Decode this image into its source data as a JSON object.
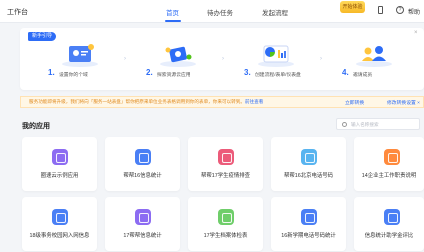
{
  "header": {
    "app_title": "工作台",
    "tabs": [
      {
        "label": "首页",
        "active": true
      },
      {
        "label": "待办任务",
        "active": false
      },
      {
        "label": "发起流程",
        "active": false
      }
    ],
    "promo_badge": "开始体验",
    "help_label": "帮助",
    "help_glyph": "?"
  },
  "guide": {
    "badge": "新手引导",
    "close_glyph": "×",
    "steps": [
      {
        "num": "1.",
        "label": "设置你的个域"
      },
      {
        "num": "2.",
        "label": "探索资源云应用"
      },
      {
        "num": "3.",
        "label": "创建流程/表单/仪表盘"
      },
      {
        "num": "4.",
        "label": "邀请成员"
      }
    ],
    "arrow": "›"
  },
  "notice": {
    "text": "服务功能即将升级，我们将向「服务一站表盘」帮你把原来单位业务表格调用到你的表单，你来可以转到。",
    "link": "前往查看",
    "action_1": "立即转换",
    "action_2": "修改转换设置 ×"
  },
  "apps": {
    "heading": "我的应用",
    "search_placeholder": "输入名称搜索",
    "items": [
      {
        "label": "圈速云示例应用",
        "color": "#8c6cf2"
      },
      {
        "label": "帮帮16信息统计",
        "color": "#4a7ff5"
      },
      {
        "label": "帮帮17学生疫情排查",
        "color": "#ec5b7a"
      },
      {
        "label": "帮帮16北京电话号码",
        "color": "#58b4f0"
      },
      {
        "label": "14企业主工作职责说明",
        "color": "#ff8a3d"
      },
      {
        "label": "18级事务校园网入网信息",
        "color": "#4a7ff5"
      },
      {
        "label": "17帮帮信息统计",
        "color": "#8c6cf2"
      },
      {
        "label": "17学生档案体检表",
        "color": "#6fce6a"
      },
      {
        "label": "16新学期电话号码统计",
        "color": "#4a7ff5"
      },
      {
        "label": "信息统计助学金评比",
        "color": "#4a7ff5"
      }
    ]
  }
}
